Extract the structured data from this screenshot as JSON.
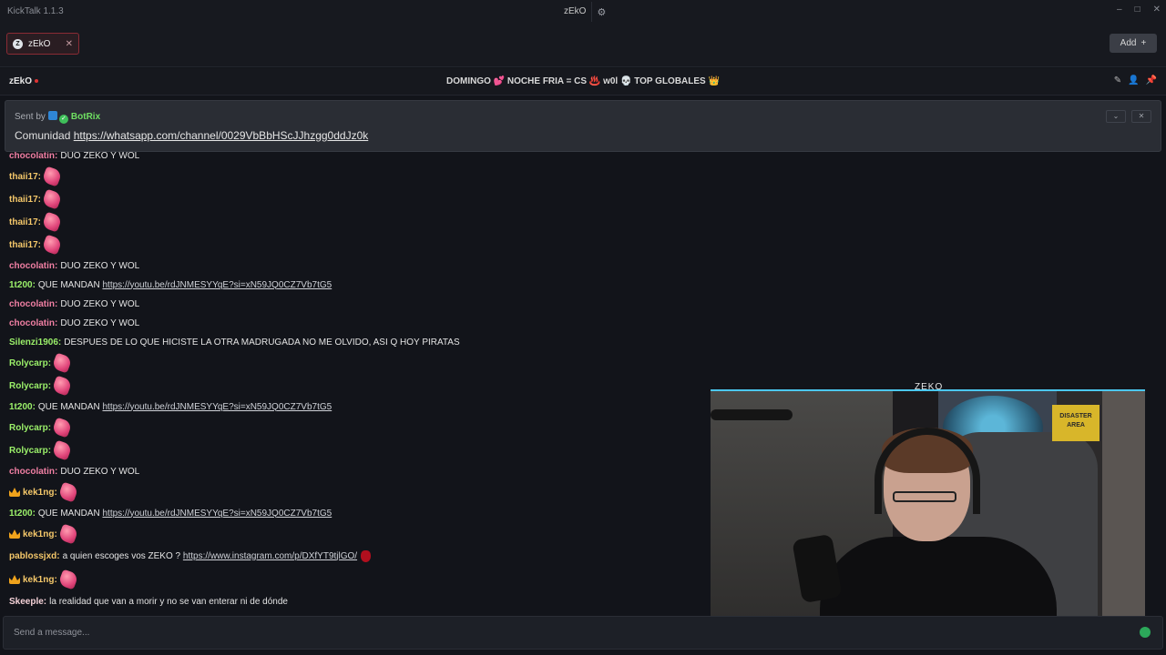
{
  "app": {
    "title": "KickTalk 1.1.3"
  },
  "center_tab": {
    "label": "zEkO"
  },
  "window_controls": {
    "minimize": "–",
    "maximize": "□",
    "close": "✕"
  },
  "tabs": [
    {
      "label": "zEkO",
      "avatar": "Z",
      "close": "✕"
    }
  ],
  "add_button": {
    "label": "Add",
    "icon": "+"
  },
  "channel": {
    "name": "zEkO",
    "stream_title": "DOMINGO 💕 NOCHE FRIA = CS ♨️ w0l 💀 TOP GLOBALES 👑"
  },
  "pinned": {
    "sent_by": "Sent by",
    "bot_name": "BotRix",
    "message_prefix": "Comunidad ",
    "link": "https://whatsapp.com/channel/0029VbBbHScJJhzgg0ddJz0k"
  },
  "messages": [
    {
      "user": "chocolatin:",
      "color": "#f07fa3",
      "text": "DUO ZEKO Y WOL"
    },
    {
      "user": "thaii17:",
      "color": "#f5c86a",
      "emote": "pink-emote"
    },
    {
      "user": "thaii17:",
      "color": "#f5c86a",
      "emote": "pink-emote"
    },
    {
      "user": "thaii17:",
      "color": "#f5c86a",
      "emote": "pink-emote"
    },
    {
      "user": "thaii17:",
      "color": "#f5c86a",
      "emote": "pink-emote"
    },
    {
      "user": "chocolatin:",
      "color": "#f07fa3",
      "text": "DUO ZEKO Y WOL"
    },
    {
      "user": "1t200:",
      "color": "#9bf06a",
      "text": "QUE MANDAN",
      "link": "https://youtu.be/rdJNMESYYqE?si=xN59JQ0CZ7Vb7tG5"
    },
    {
      "user": "chocolatin:",
      "color": "#f07fa3",
      "text": "DUO ZEKO Y WOL"
    },
    {
      "user": "chocolatin:",
      "color": "#f07fa3",
      "text": "DUO ZEKO Y WOL"
    },
    {
      "user": "Silenzi1906:",
      "color": "#9bf06a",
      "text": "DESPUES DE LO QUE HICISTE LA OTRA MADRUGADA NO ME OLVIDO, ASI Q HOY PIRATAS"
    },
    {
      "user": "Rolycarp:",
      "color": "#9bf06a",
      "emote": "pink-emote"
    },
    {
      "user": "Rolycarp:",
      "color": "#9bf06a",
      "emote": "pink-emote"
    },
    {
      "user": "1t200:",
      "color": "#9bf06a",
      "text": "QUE MANDAN",
      "link": "https://youtu.be/rdJNMESYYqE?si=xN59JQ0CZ7Vb7tG5"
    },
    {
      "user": "Rolycarp:",
      "color": "#9bf06a",
      "emote": "pink-emote"
    },
    {
      "user": "Rolycarp:",
      "color": "#9bf06a",
      "emote": "pink-emote"
    },
    {
      "user": "chocolatin:",
      "color": "#f07fa3",
      "text": "DUO ZEKO Y WOL"
    },
    {
      "user": "kek1ng:",
      "color": "#f5c86a",
      "badge": "crown",
      "emote": "pink-emote"
    },
    {
      "user": "1t200:",
      "color": "#9bf06a",
      "text": "QUE MANDAN",
      "link": "https://youtu.be/rdJNMESYYqE?si=xN59JQ0CZ7Vb7tG5"
    },
    {
      "user": "kek1ng:",
      "color": "#f5c86a",
      "badge": "crown",
      "emote": "pink-emote"
    },
    {
      "user": "pablossjxd:",
      "color": "#f5c86a",
      "text": "a quien escoges vos ZEKO ?",
      "link": "https://www.instagram.com/p/DXfYT9tjlGO/",
      "emote2": "red-emote"
    },
    {
      "user": "kek1ng:",
      "color": "#f5c86a",
      "badge": "crown",
      "emote": "pink-emote"
    },
    {
      "user": "Skeeple:",
      "color": "#f5d2d8",
      "text": "la realidad que van a morir y no se van enterar ni de dónde"
    }
  ],
  "input": {
    "placeholder": "Send a message..."
  },
  "stream_overlay": {
    "label": "ZEKO",
    "sign_text": "DISASTER AREA"
  }
}
